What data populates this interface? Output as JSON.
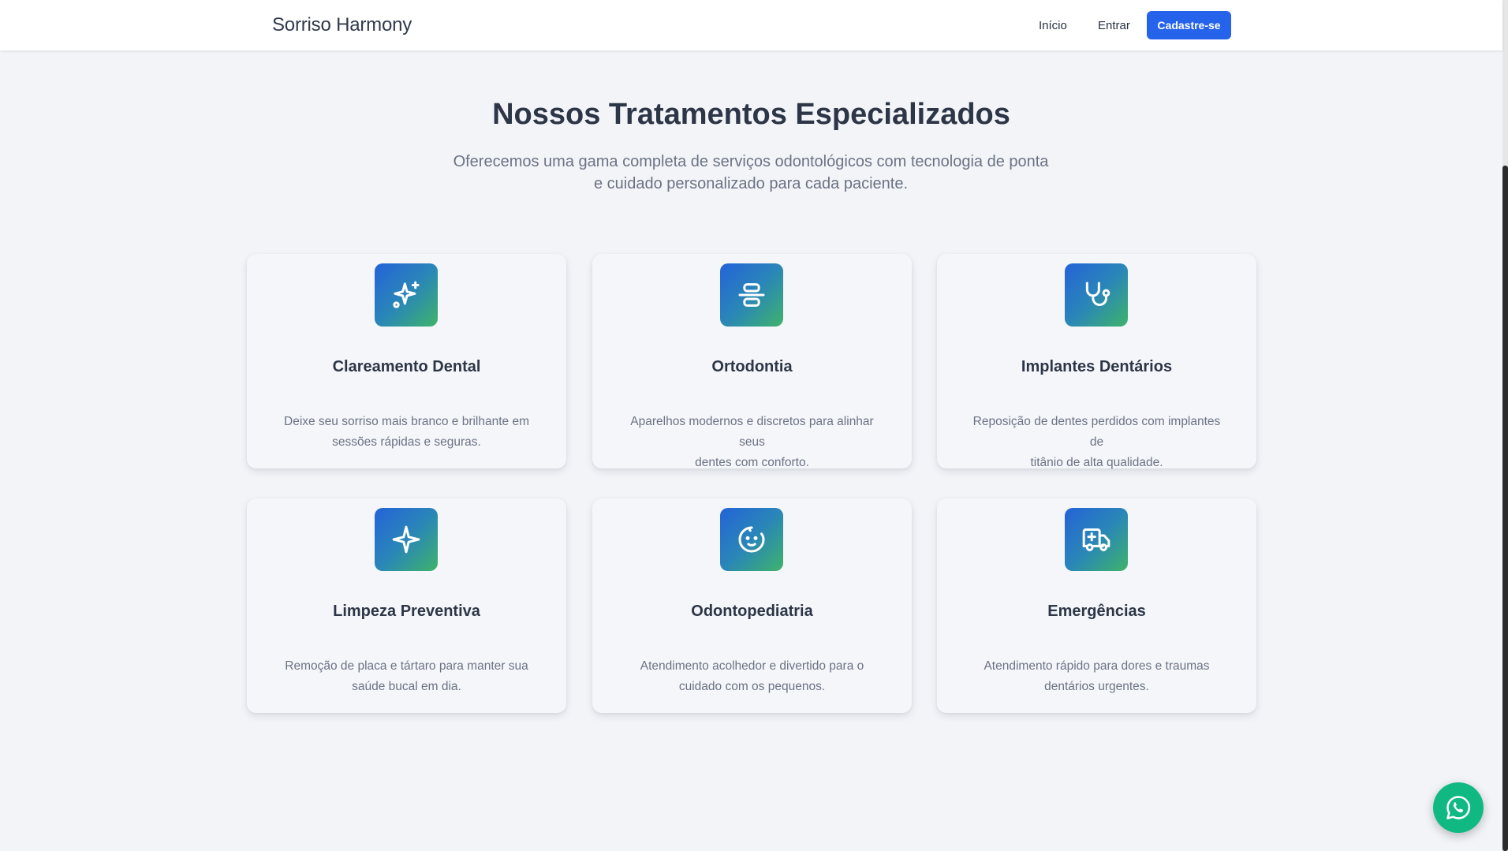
{
  "nav": {
    "brand": "Sorriso Harmony",
    "links": [
      "Início",
      "Entrar"
    ],
    "cta_label": "Cadastre-se",
    "accent": "#2563eb"
  },
  "section": {
    "title": "Nossos Tratamentos Especializados",
    "subtitle_line1": "Oferecemos uma gama completa de serviços odontológicos com tecnologia de ponta",
    "subtitle_line2": "e cuidado personalizado para cada paciente."
  },
  "cards": [
    {
      "icon": "sparkles-icon",
      "title": "Clareamento Dental",
      "desc_line1": "Deixe seu sorriso mais branco e brilhante em",
      "desc_line2": "sessões rápidas e seguras."
    },
    {
      "icon": "align-center-icon",
      "title": "Ortodontia",
      "desc_line1": "Aparelhos modernos e discretos para alinhar seus",
      "desc_line2": "dentes com conforto."
    },
    {
      "icon": "stethoscope-icon",
      "title": "Implantes Dentários",
      "desc_line1": "Reposição de dentes perdidos com implantes de",
      "desc_line2": "titânio de alta qualidade."
    },
    {
      "icon": "sparkle-icon",
      "title": "Limpeza Preventiva",
      "desc_line1": "Remoção de placa e tártaro para manter sua",
      "desc_line2": "saúde bucal em dia."
    },
    {
      "icon": "baby-icon",
      "title": "Odontopediatria",
      "desc_line1": "Atendimento acolhedor e divertido para o",
      "desc_line2": "cuidado com os pequenos."
    },
    {
      "icon": "ambulance-icon",
      "title": "Emergências",
      "desc_line1": "Atendimento rápido para dores e traumas",
      "desc_line2": "dentários urgentes."
    }
  ],
  "floating": {
    "icon": "whatsapp-icon",
    "color": "#10b981"
  }
}
